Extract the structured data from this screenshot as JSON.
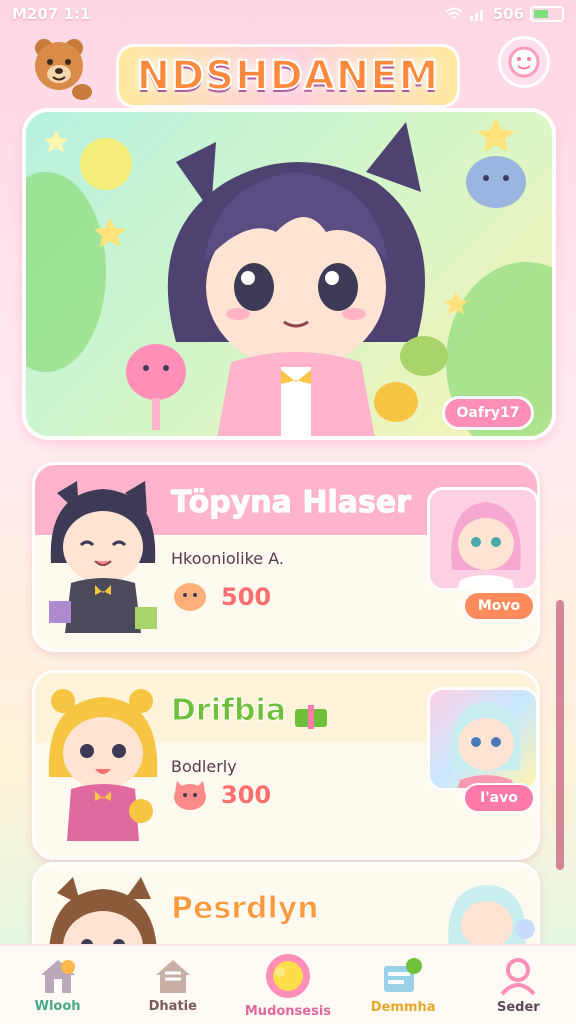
{
  "status_bar": {
    "time": "M207 1:1",
    "right_text": "506"
  },
  "header": {
    "logo_text": "NDSHDANEM"
  },
  "hero": {
    "button_label": "Oafry17"
  },
  "cards": [
    {
      "title": "Töpyna Hlaser",
      "subtitle": "Hkooniolike A.",
      "price": "500",
      "button": "Movo",
      "title_color": "#ffffff",
      "band_color": "#ffb3cc",
      "button_color": "#ff8a5c"
    },
    {
      "title": "Drifbia",
      "subtitle": "Bodlerly",
      "price": "300",
      "button": "I'avo",
      "title_color": "#6fbf3a",
      "band_color": "#fff4d9",
      "button_color": "#ff7aa8"
    },
    {
      "title": "Pesrdlyn",
      "subtitle": "",
      "price": "",
      "button": "",
      "title_color": "#ff9a3d",
      "band_color": "#fff4d9",
      "button_color": "#ff7aa8"
    }
  ],
  "nav": {
    "items": [
      {
        "label": "Wlooh",
        "color": "#4aa88a",
        "icon": "home-icon"
      },
      {
        "label": "Dhatie",
        "color": "#7a5a5a",
        "icon": "house-icon"
      },
      {
        "label": "Mudonsesis",
        "color": "#e06aa0",
        "icon": "flower-icon"
      },
      {
        "label": "Demmha",
        "color": "#e8a82a",
        "icon": "book-icon"
      },
      {
        "label": "Seder",
        "color": "#5a4a5a",
        "icon": "user-icon"
      }
    ]
  }
}
